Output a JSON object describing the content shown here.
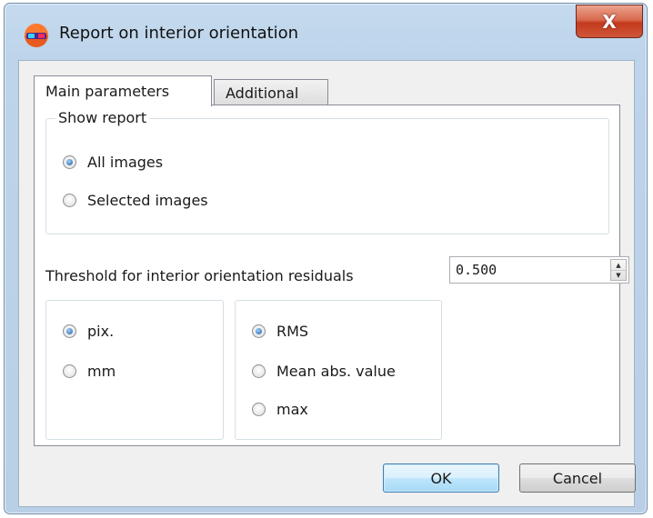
{
  "window": {
    "title": "Report on interior orientation",
    "close_label": "X"
  },
  "tabs": [
    {
      "label": "Main parameters",
      "active": true
    },
    {
      "label": "Additional",
      "active": false
    }
  ],
  "show_report": {
    "title": "Show report",
    "options": [
      {
        "label": "All images",
        "checked": true
      },
      {
        "label": "Selected images",
        "checked": false
      }
    ]
  },
  "threshold": {
    "label": "Threshold for interior orientation residuals",
    "value": "0.500"
  },
  "units": {
    "options": [
      {
        "label": "pix.",
        "checked": true
      },
      {
        "label": "mm",
        "checked": false
      }
    ]
  },
  "metric": {
    "options": [
      {
        "label": "RMS",
        "checked": true
      },
      {
        "label": "Mean abs. value",
        "checked": false
      },
      {
        "label": "max",
        "checked": false
      }
    ]
  },
  "buttons": {
    "ok": "OK",
    "cancel": "Cancel"
  },
  "icons": {
    "app": "app-logo-icon",
    "spin_up": "spin-up-icon",
    "spin_down": "spin-down-icon"
  }
}
